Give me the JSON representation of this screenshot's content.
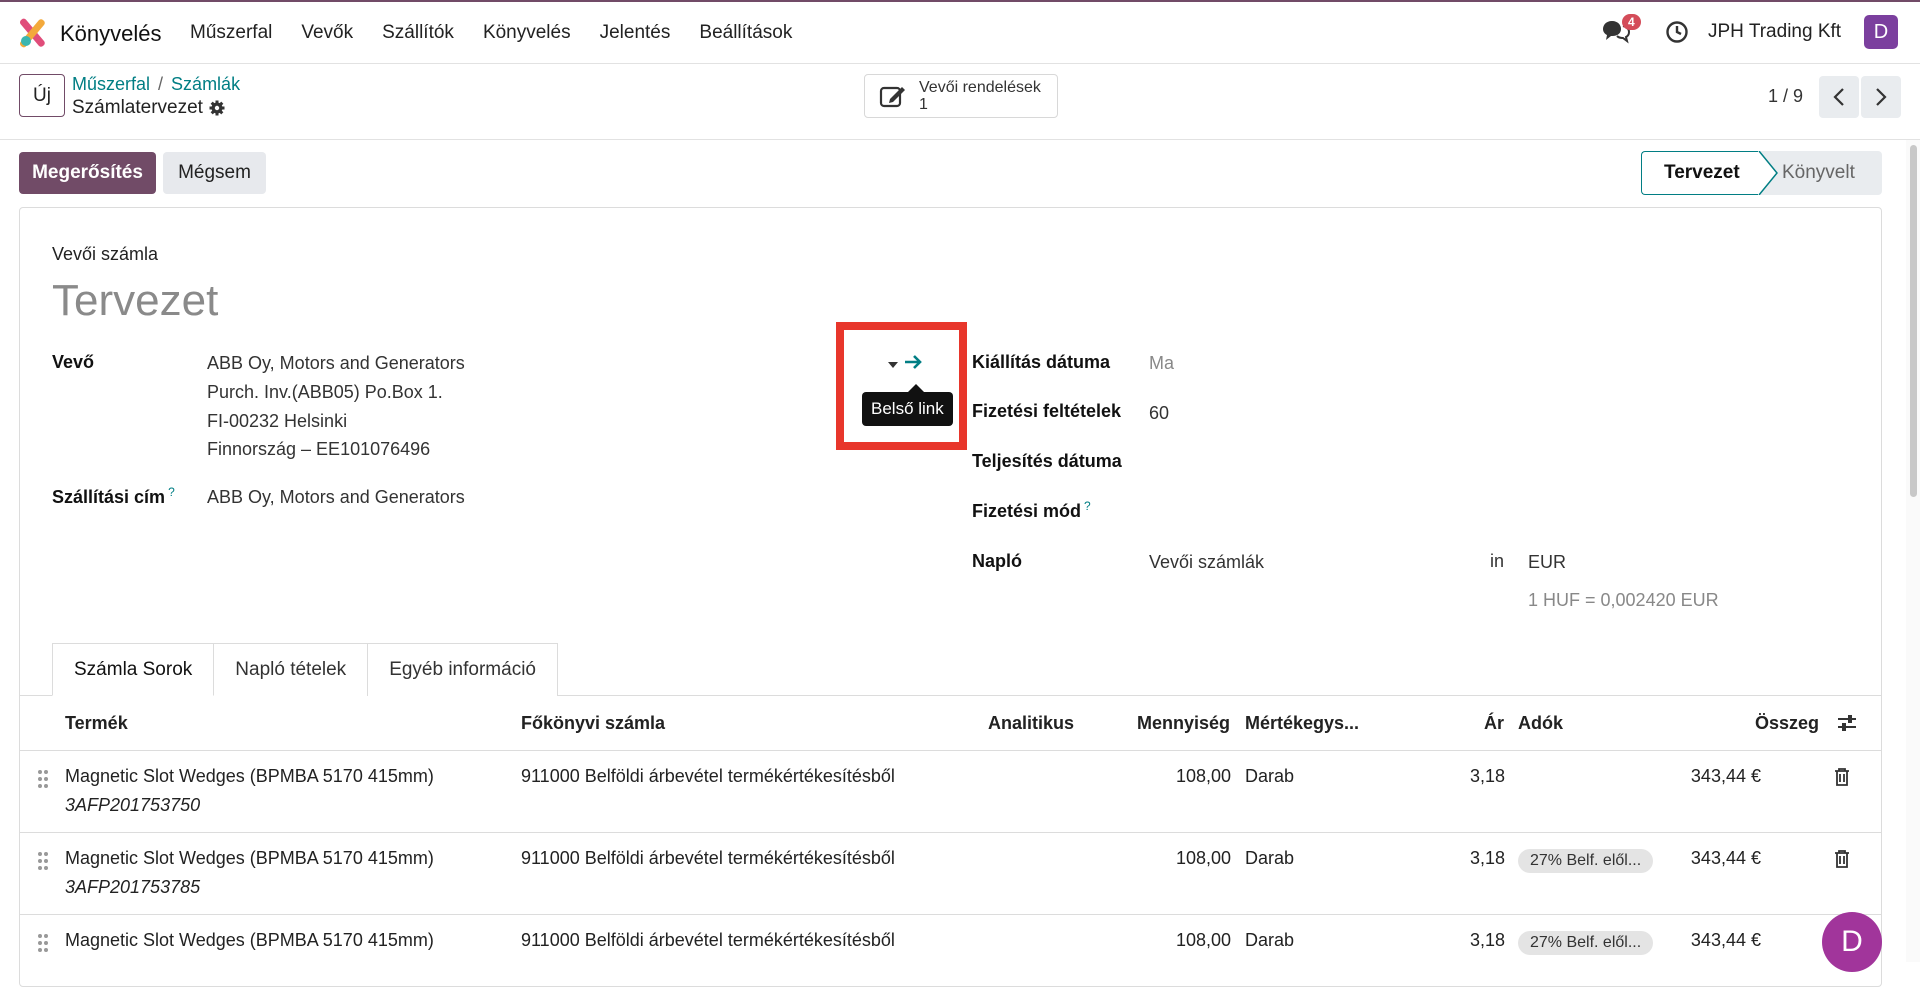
{
  "navbar": {
    "app_name": "Könyvelés",
    "menu": [
      "Műszerfal",
      "Vevők",
      "Szállítók",
      "Könyvelés",
      "Jelentés",
      "Beállítások"
    ],
    "chat_count": "4",
    "company": "JPH Trading Kft",
    "avatar": "D"
  },
  "control_panel": {
    "new_label": "Új",
    "breadcrumb": [
      "Műszerfal",
      "Számlák"
    ],
    "record_title": "Számlatervezet",
    "smart_button_label": "Vevői rendelések",
    "smart_button_count": "1",
    "pager": "1 / 9"
  },
  "status": {
    "confirm_label": "Megerősítés",
    "cancel_label": "Mégsem",
    "stages": [
      "Tervezet",
      "Könyvelt"
    ]
  },
  "form": {
    "doc_type": "Vevői számla",
    "doc_name": "Tervezet",
    "customer_label": "Vevő",
    "customer_lines": [
      "ABB Oy, Motors and Generators",
      "Purch. Inv.(ABB05) Po.Box 1.",
      "FI-00232 Helsinki",
      "Finnország – EE101076496"
    ],
    "shipping_label": "Szállítási cím",
    "shipping_value": "ABB Oy, Motors and Generators",
    "help_mark": "?",
    "tooltip": "Belső link",
    "invoice_date_label": "Kiállítás dátuma",
    "invoice_date_placeholder": "Ma",
    "payment_terms_label": "Fizetési feltételek",
    "payment_terms_value": "60",
    "delivery_date_label": "Teljesítés dátuma",
    "payment_method_label": "Fizetési mód",
    "journal_label": "Napló",
    "journal_value": "Vevői számlák",
    "in_label": "in",
    "currency": "EUR",
    "rate": "1 HUF = 0,002420 EUR"
  },
  "tabs": [
    "Számla Sorok",
    "Napló tételek",
    "Egyéb információ"
  ],
  "table": {
    "headers": [
      "Termék",
      "Főkönyvi számla",
      "Analitikus",
      "Mennyiség",
      "Mértékegys...",
      "Ár",
      "Adók",
      "Összeg"
    ],
    "rows": [
      {
        "product": "Magnetic Slot Wedges (BPMBA 5170 415mm)",
        "sub": "3AFP201753750",
        "account": "911000 Belföldi árbevétel termékértékesítésből",
        "qty": "108,00",
        "uom": "Darab",
        "price": "3,18",
        "tax": "",
        "amount": "343,44 €"
      },
      {
        "product": "Magnetic Slot Wedges (BPMBA 5170 415mm)",
        "sub": "3AFP201753785",
        "account": "911000 Belföldi árbevétel termékértékesítésből",
        "qty": "108,00",
        "uom": "Darab",
        "price": "3,18",
        "tax": "27% Belf. elől...",
        "amount": "343,44 €"
      },
      {
        "product": "Magnetic Slot Wedges (BPMBA 5170 415mm)",
        "sub": "",
        "account": "911000 Belföldi árbevétel termékértékesítésből",
        "qty": "108,00",
        "uom": "Darab",
        "price": "3,18",
        "tax": "27% Belf. elől...",
        "amount": "343,44 €"
      }
    ]
  },
  "chat_avatar": "D",
  "colors": {
    "brand": "#714b67",
    "link": "#017e84",
    "highlight": "#e8362b"
  }
}
